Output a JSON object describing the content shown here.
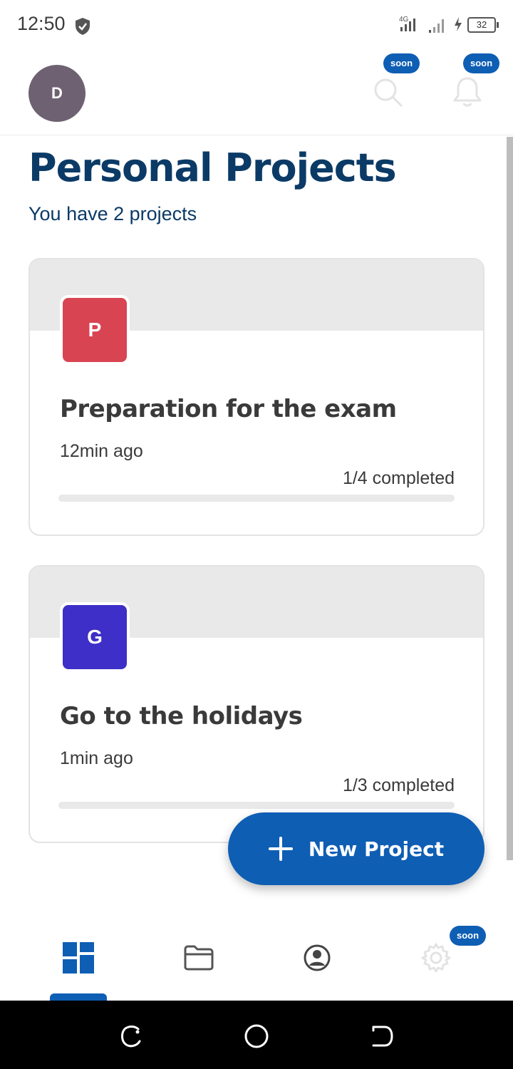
{
  "status_bar": {
    "time": "12:50",
    "network": "4G",
    "battery": "32"
  },
  "header": {
    "avatar_initial": "D",
    "search_badge": "soon",
    "notifications_badge": "soon"
  },
  "page": {
    "title": "Personal Projects",
    "subtitle": "You have 2 projects"
  },
  "projects": [
    {
      "initial": "P",
      "color": "#d94452",
      "name": "Preparation for the exam",
      "updated": "12min ago",
      "progress_label": "1/4 completed",
      "progress": 0.25
    },
    {
      "initial": "G",
      "color": "#3d2fc7",
      "name": "Go to the holidays",
      "updated": "1min ago",
      "progress_label": "1/3 completed",
      "progress": 0.333
    }
  ],
  "fab": {
    "label": "New Project"
  },
  "bottom_nav": {
    "items": [
      {
        "icon": "dashboard-icon",
        "active": true
      },
      {
        "icon": "folder-icon",
        "active": false
      },
      {
        "icon": "account-icon",
        "active": false
      },
      {
        "icon": "settings-icon",
        "active": false
      }
    ],
    "settings_badge": "soon"
  },
  "colors": {
    "primary": "#0e5eb4",
    "title": "#0b3a66"
  }
}
